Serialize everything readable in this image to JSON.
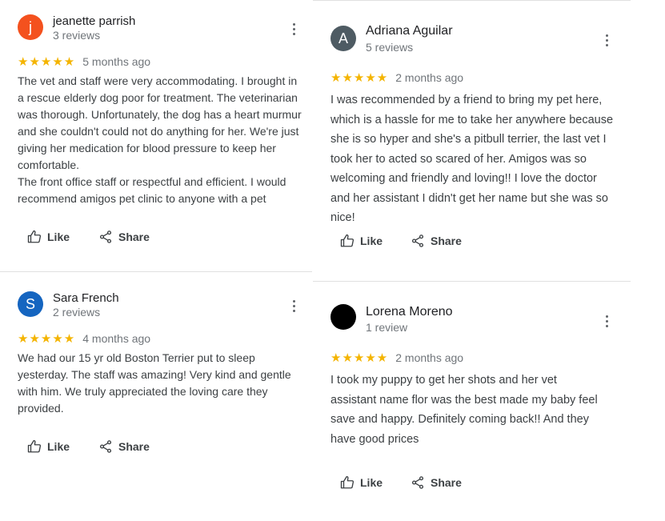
{
  "colors": {
    "star": "#f4b400",
    "avatar_j": "#f4511e",
    "avatar_a": "#4e5b63",
    "avatar_s": "#1565c0",
    "avatar_l": "#000000"
  },
  "reviews": [
    {
      "initial": "j",
      "name": "jeanette parrish",
      "count": "3 reviews",
      "stars": "★★★★★",
      "date": "5 months ago",
      "text": [
        "The vet and staff were very accommodating. I brought in a rescue elderly dog poor for treatment. The veterinarian was thorough.  Unfortunately, the dog has a heart murmur and she couldn't could not do anything for her. We're just giving her medication for blood pressure to keep her comfortable.",
        "The front office staff or respectful and efficient. I would recommend amigos pet clinic to anyone with a pet"
      ],
      "like_label": "Like",
      "share_label": "Share"
    },
    {
      "initial": "A",
      "name": "Adriana Aguilar",
      "count": "5 reviews",
      "stars": "★★★★★",
      "date": "2 months ago",
      "text": [
        "I was recommended by a friend to bring my pet here, which is a hassle for me to take her anywhere because she is so hyper and she's a pitbull terrier, the last vet I took her to acted so scared of her. Amigos was so welcoming and friendly and loving!! I love the doctor and her assistant I didn't get her name but she was so nice!"
      ],
      "like_label": "Like",
      "share_label": "Share"
    },
    {
      "initial": "S",
      "name": "Sara French",
      "count": "2 reviews",
      "stars": "★★★★★",
      "date": "4 months ago",
      "text": [
        "We had our 15 yr old Boston Terrier put to sleep yesterday. The staff was amazing! Very kind and gentle with him. We truly appreciated the loving care they provided."
      ],
      "like_label": "Like",
      "share_label": "Share"
    },
    {
      "initial": "",
      "name": "Lorena Moreno",
      "count": "1 review",
      "stars": "★★★★★",
      "date": "2 months ago",
      "text": [
        "I took my puppy to get her shots and her vet assistant name flor was the best made my baby feel save and happy. Definitely coming back!! And they have good prices"
      ],
      "like_label": "Like",
      "share_label": "Share"
    }
  ]
}
